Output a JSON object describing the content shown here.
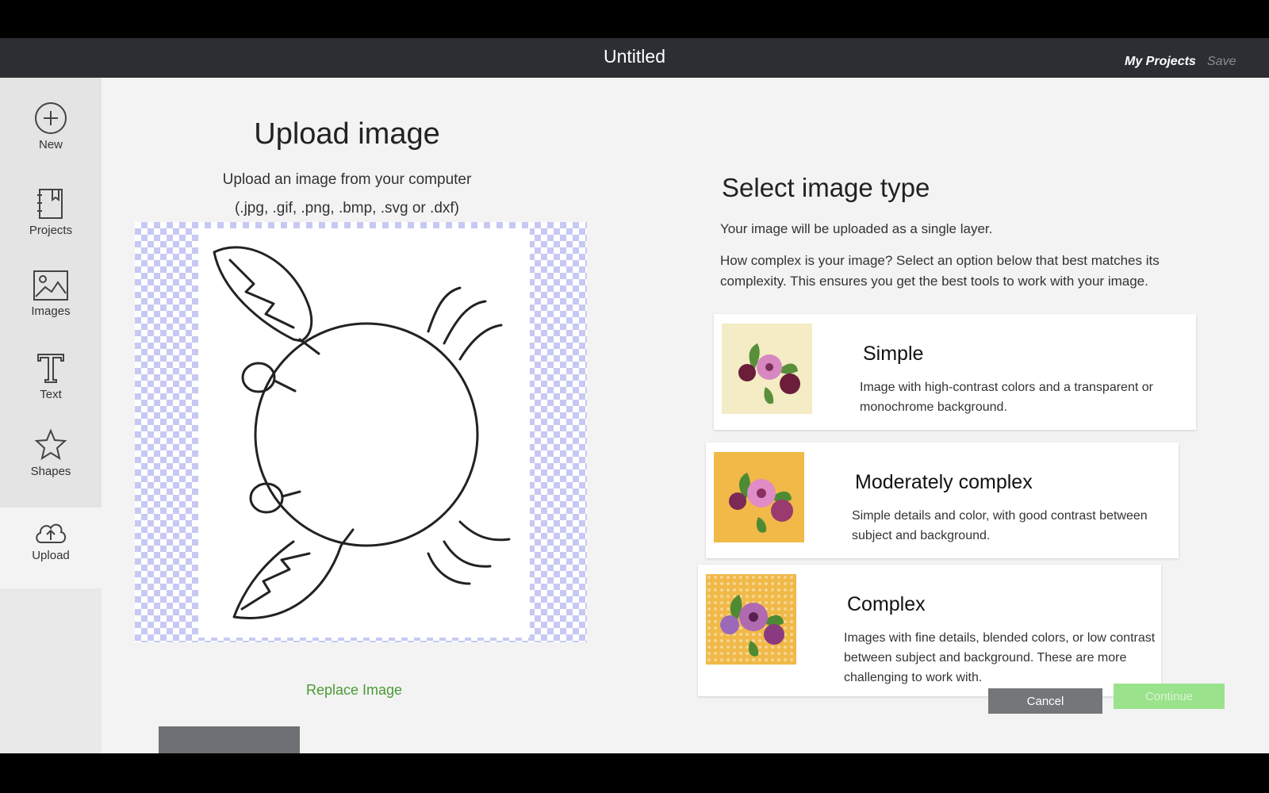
{
  "app": {
    "title": "Untitled",
    "my_projects": "My Projects",
    "save": "Save"
  },
  "sidebar": {
    "items": [
      {
        "label": "New",
        "icon": "plus-circle-icon"
      },
      {
        "label": "Projects",
        "icon": "notebook-icon"
      },
      {
        "label": "Images",
        "icon": "image-icon"
      },
      {
        "label": "Text",
        "icon": "text-T-icon"
      },
      {
        "label": "Shapes",
        "icon": "star-shape-icon"
      },
      {
        "label": "Upload",
        "icon": "cloud-upload-icon",
        "active": true
      }
    ]
  },
  "upload": {
    "title": "Upload image",
    "subtitle": "Upload an image from your computer",
    "formats": "(.jpg, .gif, .png, .bmp, .svg or .dxf)",
    "replace_label": "Replace Image"
  },
  "image_type": {
    "title": "Select image type",
    "single_layer": "Your image will be uploaded as a single layer.",
    "question": "How complex is your image? Select an option below that best matches its complexity. This ensures you get the best tools to work with your image.",
    "options": [
      {
        "title": "Simple",
        "description": "Image with high-contrast colors and a transparent or monochrome background."
      },
      {
        "title": "Moderately complex",
        "description": "Simple details and color, with good contrast between subject and background."
      },
      {
        "title": "Complex",
        "description": "Images with fine details, blended colors, or low contrast between subject and background. These are more challenging to work with."
      }
    ]
  },
  "actions": {
    "cancel": "Cancel",
    "continue": "Continue"
  },
  "colors": {
    "accent_green": "#4b9a35",
    "topbar": "#2b2f33",
    "continue_bg": "#9be28c"
  }
}
